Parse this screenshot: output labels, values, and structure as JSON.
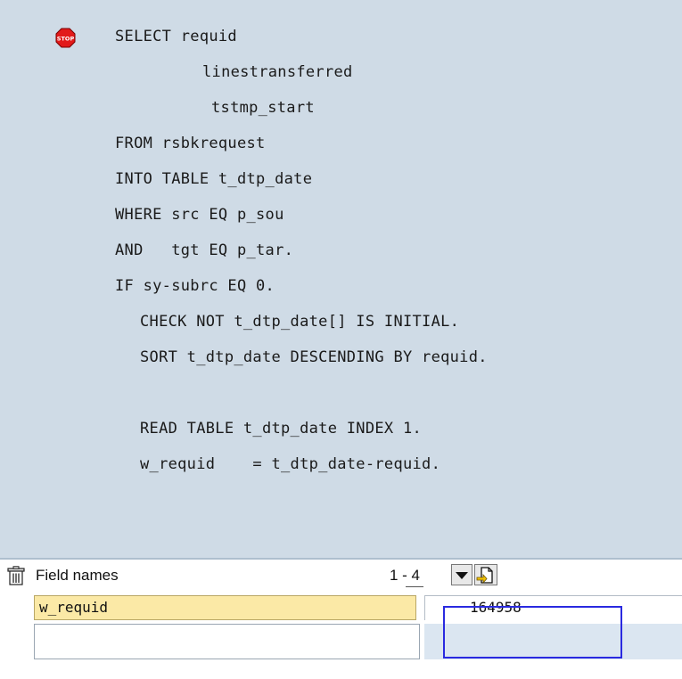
{
  "code": {
    "breakpoint_icon": "stop-sign-icon",
    "lines": [
      "SELECT requid",
      "linestransferred",
      "tstmp_start",
      "FROM rsbkrequest",
      "INTO TABLE t_dtp_date",
      "WHERE src EQ p_sou",
      "AND   tgt EQ p_tar.",
      "IF sy-subrc EQ 0.",
      "CHECK NOT t_dtp_date[] IS INITIAL.",
      "SORT t_dtp_date DESCENDING BY requid.",
      "READ TABLE t_dtp_date INDEX 1.",
      "w_requid    = t_dtp_date-requid."
    ]
  },
  "variables": {
    "header_label": "Field names",
    "range_text": "1 - 4",
    "icons": [
      "trash-icon",
      "dropdown-arrow-icon",
      "new-document-icon"
    ],
    "rows": [
      {
        "name": "w_requid",
        "value": "164958"
      },
      {
        "name": "",
        "value": ""
      }
    ]
  },
  "colors": {
    "code_background": "#cfdbe6",
    "field_highlight": "#fbe9a6",
    "annotation_box": "#2a2ae0"
  }
}
